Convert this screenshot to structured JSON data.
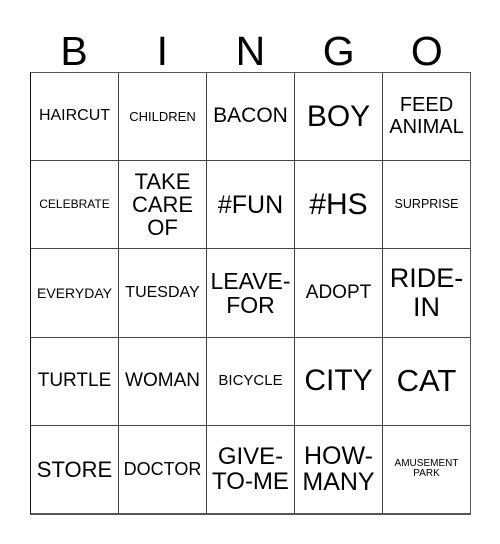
{
  "card": {
    "header_letters": [
      "B",
      "I",
      "N",
      "G",
      "O"
    ],
    "columns": 5,
    "rows": 5,
    "background_color": "#ffffff",
    "text_color": "#000000",
    "border_color": "#444444",
    "cells": [
      [
        {
          "text": "HAIRCUT",
          "font_size": "16px"
        },
        {
          "text": "CHILDREN",
          "font_size": "13px"
        },
        {
          "text": "BACON",
          "font_size": "21px"
        },
        {
          "text": "BOY",
          "font_size": "30px"
        },
        {
          "text": "FEED\nANIMAL",
          "font_size": "20px"
        }
      ],
      [
        {
          "text": "CELEBRATE",
          "font_size": "12px"
        },
        {
          "text": "TAKE\nCARE\nOF",
          "font_size": "22px"
        },
        {
          "text": "#FUN",
          "font_size": "25px"
        },
        {
          "text": "#HS",
          "font_size": "30px"
        },
        {
          "text": "SURPRISE",
          "font_size": "12.5px"
        }
      ],
      [
        {
          "text": "EVERYDAY",
          "font_size": "14px"
        },
        {
          "text": "TUESDAY",
          "font_size": "16px"
        },
        {
          "text": "LEAVE-\nFOR",
          "font_size": "23px"
        },
        {
          "text": "ADOPT",
          "font_size": "19px"
        },
        {
          "text": "RIDE-\nIN",
          "font_size": "27px"
        }
      ],
      [
        {
          "text": "TURTLE",
          "font_size": "19px"
        },
        {
          "text": "WOMAN",
          "font_size": "19px"
        },
        {
          "text": "BICYCLE",
          "font_size": "15px"
        },
        {
          "text": "CITY",
          "font_size": "30px"
        },
        {
          "text": "CAT",
          "font_size": "31px"
        }
      ],
      [
        {
          "text": "STORE",
          "font_size": "22px"
        },
        {
          "text": "DOCTOR",
          "font_size": "18px"
        },
        {
          "text": "GIVE-\nTO-ME",
          "font_size": "24px"
        },
        {
          "text": "HOW-\nMANY",
          "font_size": "25px"
        },
        {
          "text": "AMUSEMENT\nPARK",
          "font_size": "10px"
        }
      ]
    ]
  }
}
